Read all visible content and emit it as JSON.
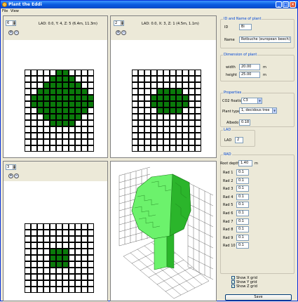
{
  "window": {
    "title": "Plant the Eddi"
  },
  "menu": {
    "items": [
      "File",
      "View"
    ]
  },
  "view_top_left": {
    "spinner_value": "6",
    "lad_info": "LAD: 0.0,     Y: 4, Z: 5  (6.4m, 11.3m)",
    "cells": [
      [
        0,
        0,
        0,
        0,
        0,
        1,
        1,
        0,
        0,
        0,
        0
      ],
      [
        0,
        0,
        0,
        0,
        1,
        1,
        1,
        1,
        0,
        0,
        0
      ],
      [
        0,
        0,
        0,
        1,
        1,
        1,
        1,
        1,
        1,
        0,
        0
      ],
      [
        0,
        0,
        1,
        1,
        1,
        1,
        1,
        1,
        1,
        1,
        0
      ],
      [
        0,
        1,
        1,
        1,
        1,
        1,
        1,
        1,
        1,
        1,
        1
      ],
      [
        0,
        1,
        1,
        1,
        1,
        1,
        1,
        1,
        1,
        1,
        1
      ],
      [
        0,
        0,
        1,
        1,
        1,
        1,
        1,
        1,
        1,
        1,
        0
      ],
      [
        0,
        0,
        0,
        1,
        1,
        1,
        1,
        1,
        1,
        0,
        0
      ],
      [
        0,
        0,
        0,
        0,
        1,
        1,
        1,
        1,
        0,
        0,
        0
      ],
      [
        0,
        0,
        0,
        0,
        0,
        0,
        0,
        0,
        0,
        0,
        0
      ],
      [
        0,
        0,
        0,
        0,
        0,
        0,
        0,
        0,
        0,
        0,
        0
      ],
      [
        0,
        0,
        0,
        0,
        0,
        0,
        0,
        0,
        0,
        0,
        0
      ],
      [
        0,
        0,
        0,
        0,
        0,
        0,
        0,
        0,
        0,
        0,
        0
      ]
    ]
  },
  "view_top_right": {
    "spinner_value": "2",
    "lad_info": "LAD: 0.0,     X: 3, Z: 1  (4.5m, 1.1m)",
    "cells": [
      [
        0,
        0,
        0,
        0,
        0,
        0,
        0,
        0,
        0,
        0,
        0
      ],
      [
        0,
        0,
        0,
        0,
        0,
        0,
        0,
        0,
        0,
        0,
        0
      ],
      [
        0,
        0,
        0,
        0,
        0,
        0,
        0,
        0,
        0,
        0,
        0
      ],
      [
        0,
        0,
        0,
        0,
        1,
        1,
        1,
        1,
        0,
        0,
        0
      ],
      [
        0,
        0,
        0,
        1,
        1,
        1,
        1,
        1,
        1,
        0,
        0
      ],
      [
        0,
        0,
        0,
        1,
        1,
        1,
        1,
        1,
        1,
        0,
        0
      ],
      [
        0,
        0,
        0,
        0,
        1,
        1,
        1,
        1,
        0,
        0,
        0
      ],
      [
        0,
        0,
        0,
        0,
        0,
        0,
        0,
        0,
        0,
        0,
        0
      ],
      [
        0,
        0,
        0,
        0,
        0,
        0,
        0,
        0,
        0,
        0,
        0
      ],
      [
        0,
        0,
        0,
        0,
        0,
        0,
        0,
        0,
        0,
        0,
        0
      ],
      [
        0,
        0,
        0,
        0,
        0,
        0,
        0,
        0,
        0,
        0,
        0
      ],
      [
        0,
        0,
        0,
        0,
        0,
        0,
        0,
        0,
        0,
        0,
        0
      ],
      [
        0,
        0,
        0,
        0,
        0,
        0,
        0,
        0,
        0,
        0,
        0
      ]
    ]
  },
  "view_bottom_left": {
    "spinner_value": "3",
    "cells": [
      [
        0,
        0,
        0,
        0,
        0,
        0,
        0,
        0,
        0,
        0,
        0
      ],
      [
        0,
        0,
        0,
        0,
        0,
        0,
        0,
        0,
        0,
        0,
        0
      ],
      [
        0,
        0,
        0,
        0,
        0,
        0,
        0,
        0,
        0,
        0,
        0
      ],
      [
        0,
        0,
        0,
        0,
        0,
        0,
        0,
        0,
        0,
        0,
        0
      ],
      [
        0,
        0,
        0,
        0,
        1,
        1,
        1,
        0,
        0,
        0,
        0
      ],
      [
        0,
        0,
        0,
        0,
        1,
        1,
        1,
        0,
        0,
        0,
        0
      ],
      [
        0,
        0,
        0,
        0,
        1,
        1,
        1,
        0,
        0,
        0,
        0
      ],
      [
        0,
        0,
        0,
        0,
        0,
        0,
        0,
        0,
        0,
        0,
        0
      ],
      [
        0,
        0,
        0,
        0,
        0,
        0,
        0,
        0,
        0,
        0,
        0
      ],
      [
        0,
        0,
        0,
        0,
        0,
        0,
        0,
        0,
        0,
        0,
        0
      ],
      [
        0,
        0,
        0,
        0,
        0,
        0,
        0,
        0,
        0,
        0,
        0
      ]
    ]
  },
  "panel": {
    "id_group_title": "ID and Name of plant",
    "id_label": "ID",
    "id_value": "Bi",
    "name_label": "Name",
    "name_value": "Rotbuche (european beech)",
    "dim_group_title": "Dimension of plant",
    "width_label": "width",
    "width_value": "20.00",
    "width_unit": "m",
    "height_label": "height",
    "height_value": "25.00",
    "height_unit": "m",
    "props_group_title": "Properties",
    "co2_label": "CO2 fixation",
    "co2_value": "C3",
    "plant_type_label": "Plant type",
    "plant_type_value": "1, decidous tree",
    "albedo_label": "Albedo",
    "albedo_value": "0.18",
    "lad_group_title": "LAD",
    "lad_label": "LAD",
    "lad_value": "2",
    "rad_group_title": "RAD",
    "root_depth_label": "Root depth",
    "root_depth_value": "1.40",
    "root_depth_unit": "m",
    "rad_rows": [
      {
        "label": "Rad 1",
        "value": "0.1"
      },
      {
        "label": "Rad 2",
        "value": "0.1"
      },
      {
        "label": "Rad 3",
        "value": "0.1"
      },
      {
        "label": "Rad 4",
        "value": "0.1"
      },
      {
        "label": "Rad 5",
        "value": "0.1"
      },
      {
        "label": "Rad 6",
        "value": "0.1"
      },
      {
        "label": "Rad 7",
        "value": "0.1"
      },
      {
        "label": "Rad 8",
        "value": "0.1"
      },
      {
        "label": "Rad 9",
        "value": "0.1"
      },
      {
        "label": "Rad 10",
        "value": "0.1"
      }
    ],
    "checkboxes": [
      {
        "label": "Show X grid",
        "checked": true
      },
      {
        "label": "Show Y grid",
        "checked": true
      },
      {
        "label": "Show Z grid",
        "checked": true
      }
    ],
    "save_label": "Save"
  },
  "colors": {
    "leaf": "#0a7a0a",
    "tree_3d_light": "#6cf26c",
    "tree_3d_dark": "#2bb52b"
  }
}
